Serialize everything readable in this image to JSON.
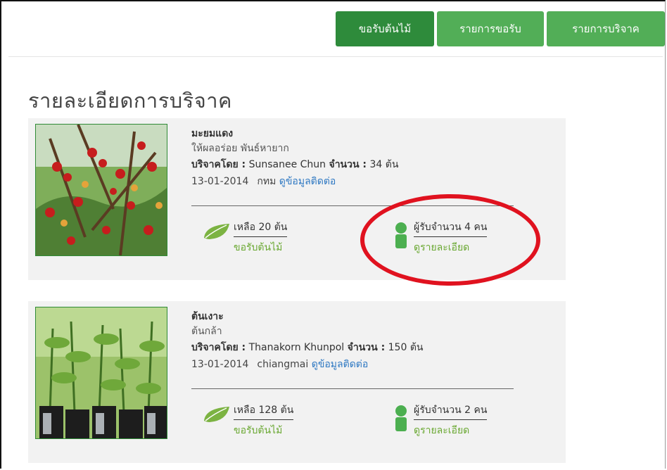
{
  "nav": {
    "request_tree": "ขอรับต้นไม้",
    "request_list": "รายการขอรับ",
    "donation_list": "รายการบริจาค"
  },
  "page_title": "รายละเอียดการบริจาค",
  "donations": [
    {
      "name": "มะยมแดง",
      "description": "ให้ผลอร่อย พันธ์หายาก",
      "donated_by_label": "บริจาคโดย :",
      "donor": "Sunsanee Chun",
      "quantity_label": "จำนวน :",
      "quantity": "34 ต้น",
      "date": "13-01-2014",
      "location": "กทม",
      "contact_link": "ดูข้อมูลติดต่อ",
      "remaining": "เหลือ 20 ต้น",
      "request_action": "ขอรับต้นไม้",
      "recipients": "ผู้รับจำนวน 4 คน",
      "details_link": "ดูรายละเอียด",
      "photo_icon": "red-fruit-tree-photo"
    },
    {
      "name": "ต้นเงาะ",
      "description": "ต้นกล้า",
      "donated_by_label": "บริจาคโดย :",
      "donor": "Thanakorn Khunpol",
      "quantity_label": "จำนวน :",
      "quantity": "150 ต้น",
      "date": "13-01-2014",
      "location": "chiangmai",
      "contact_link": "ดูข้อมูลติดต่อ",
      "remaining": "เหลือ 128 ต้น",
      "request_action": "ขอรับต้นไม้",
      "recipients": "ผู้รับจำนวน 2 คน",
      "details_link": "ดูรายละเอียด",
      "photo_icon": "seedlings-photo"
    }
  ],
  "colors": {
    "primary_green": "#2e8b3b",
    "light_green": "#52ae57",
    "link_blue": "#2e78c2",
    "accent_green_text": "#6aa832",
    "annotation_red": "#e0121f"
  }
}
